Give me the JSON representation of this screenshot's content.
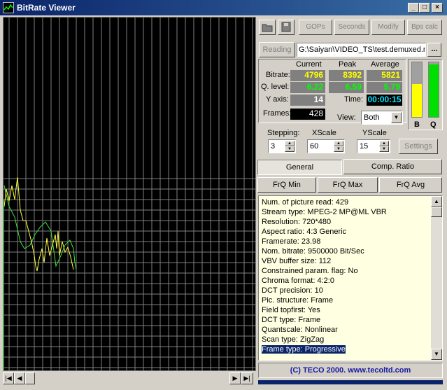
{
  "window": {
    "title": "BitRate Viewer"
  },
  "caption_buttons": {
    "minimize": "_",
    "maximize": "□",
    "close": "×"
  },
  "toolbar": {
    "gops": "GOPs",
    "seconds": "Seconds",
    "modify": "Modify",
    "bps_calc": "Bps calc"
  },
  "file": {
    "reading_label": "Reading",
    "path": "G:\\Saiyan\\VIDEO_TS\\test.demuxed.m",
    "browse": "..."
  },
  "stats": {
    "headers": {
      "current": "Current",
      "peak": "Peak",
      "average": "Average"
    },
    "bitrate": {
      "label": "Bitrate:",
      "current": "4796",
      "peak": "8392",
      "average": "5821"
    },
    "qlevel": {
      "label": "Q. level:",
      "current": "6.22",
      "peak": "6.59",
      "average": "5.79"
    },
    "yaxis": {
      "label": "Y axis:",
      "value": "14"
    },
    "time": {
      "label": "Time:",
      "value": "00:00:15"
    },
    "frames": {
      "label": "Frames:",
      "value": "428"
    },
    "view": {
      "label": "View:",
      "value": "Both"
    }
  },
  "meters": {
    "b_label": "B",
    "q_label": "Q",
    "b_level": 0.6,
    "q_level": 0.96,
    "b_color": "#ffff00",
    "q_color": "#00e000"
  },
  "controls": {
    "stepping": {
      "label": "Stepping:",
      "value": "3"
    },
    "xscale": {
      "label": "XScale",
      "value": "60"
    },
    "yscale": {
      "label": "YScale",
      "value": "15"
    },
    "settings": "Settings"
  },
  "tabs": {
    "general": "General",
    "comp_ratio": "Comp. Ratio"
  },
  "frq": {
    "min": "FrQ Min",
    "max": "FrQ Max",
    "avg": "FrQ Avg"
  },
  "info_lines": [
    "Num. of picture read: 429",
    "Stream type: MPEG-2  MP@ML  VBR",
    "Resolution: 720*480",
    "Aspect ratio: 4:3 Generic",
    "Framerate: 23.98",
    "Nom. bitrate: 9500000 Bit/Sec",
    "VBV buffer size: 112",
    "Constrained param. flag: No",
    "Chroma format: 4:2:0",
    "DCT precision: 10",
    "Pic. structure: Frame",
    "Field topfirst: Yes",
    "DCT type: Frame",
    "Quantscale: Nonlinear",
    "Scan type: ZigZag",
    "Frame type: Progressive"
  ],
  "footer": {
    "copyright": "(C) TECO 2000. www.tecoltd.com"
  },
  "graph": {
    "background": "#000000",
    "grid_color": "#808080",
    "bitrate_color": "#ffff40",
    "qlevel_color": "#40e040"
  }
}
